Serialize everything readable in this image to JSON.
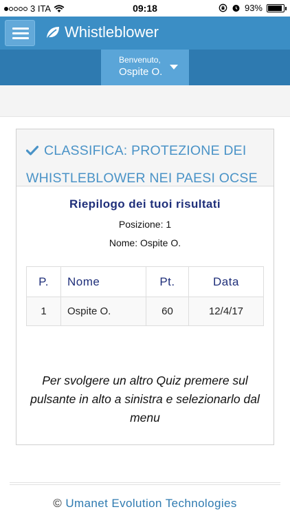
{
  "status_bar": {
    "carrier": "3 ITA",
    "time": "09:18",
    "battery": "93%",
    "battery_level": 0.93,
    "signal_bars_filled": 1
  },
  "navbar": {
    "app_title": "Whistleblower",
    "greeting": "Benvenuto,",
    "user_name": "Ospite O."
  },
  "panel": {
    "title": "CLASSIFICA: PROTEZIONE DEI WHISTLEBLOWER NEI PAESI OCSE",
    "summary_title": "Riepilogo dei tuoi risultati",
    "position_line": "Posizione: 1",
    "name_line": "Nome: Ospite O.",
    "table": {
      "headers": [
        "P.",
        "Nome",
        "Pt.",
        "Data"
      ],
      "rows": [
        [
          "1",
          "Ospite O.",
          "60",
          "12/4/17"
        ]
      ]
    },
    "instructions": "Per svolgere un altro Quiz premere sul pulsante in alto a sinistra e selezionarlo dal menu"
  },
  "footer": {
    "copyright_symbol": "©",
    "company": "Umanet Evolution Technologies"
  },
  "colors": {
    "navbar": "#3b8ec5",
    "subbar": "#2e7ab0",
    "accent_title": "#4a93c7",
    "dark_heading": "#1f2f7a"
  }
}
